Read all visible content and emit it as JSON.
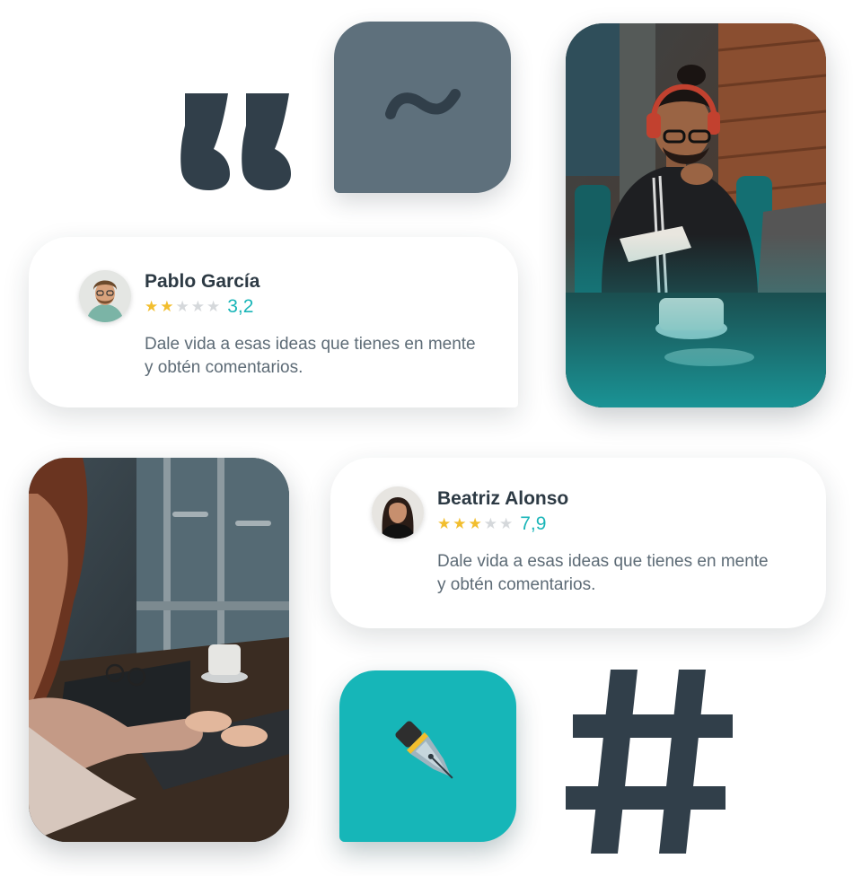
{
  "colors": {
    "dark": "#313f4a",
    "slate_tile": "#5e707c",
    "teal_tile": "#16b6b8",
    "star_on": "#f2be2e",
    "star_off": "#d5d8db",
    "score": "#19b5b8"
  },
  "icons": {
    "quote": "quote-icon",
    "tilde": "tilde-icon",
    "pen": "fountain-pen-icon",
    "hash": "hash-icon"
  },
  "reviews": [
    {
      "name": "Pablo García",
      "stars_on": 2,
      "stars_total": 5,
      "score": "3,2",
      "text": "Dale vida a esas ideas que tienes en mente y obtén comentarios."
    },
    {
      "name": "Beatriz Alonso",
      "stars_on": 3,
      "stars_total": 5,
      "score": "7,9",
      "text": "Dale vida a esas ideas que tienes en mente y obtén comentarios."
    }
  ]
}
